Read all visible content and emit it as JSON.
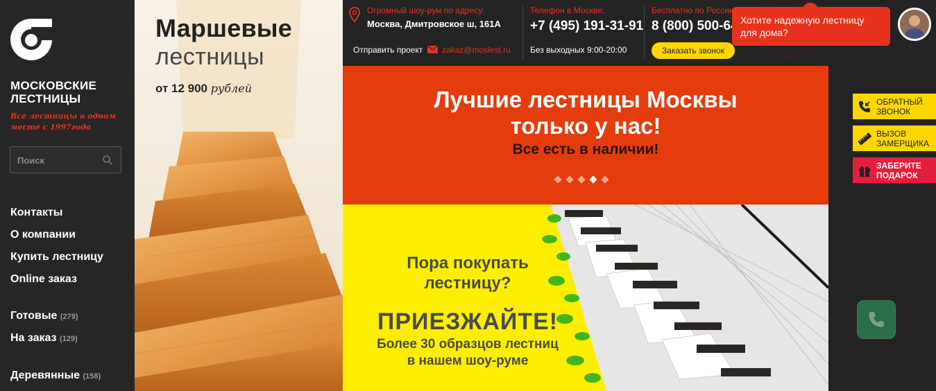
{
  "brand": {
    "name_line1": "МОСКОВСКИЕ",
    "name_line2": "ЛЕСТНИЦЫ",
    "tagline": "Все лестницы в одном месте с 1997года"
  },
  "search": {
    "placeholder": "Поиск"
  },
  "nav": {
    "items": [
      {
        "label": "Контакты"
      },
      {
        "label": "О компании"
      },
      {
        "label": "Купить лестницу"
      },
      {
        "label": "Online заказ"
      }
    ],
    "catalog": [
      {
        "label": "Готовые",
        "count": "(279)"
      },
      {
        "label": "На заказ",
        "count": "(129)"
      },
      {
        "label": "Деревянные",
        "count": "(158)"
      }
    ]
  },
  "stair_banner": {
    "title": "Маршевые",
    "subtitle": "лестницы",
    "price_prefix": "от 12 900",
    "price_unit": "рублей"
  },
  "topbar": {
    "showroom_label": "Огромный шоу-рум по адресу:",
    "showroom_address": "Москва, Дмитровское ш, 161А",
    "send_project_label": "Отправить проект",
    "email": "zakaz@moslest.ru",
    "moscow_phone_label": "Телефон в Москве:",
    "moscow_phone": "+7 (495) 191-31-91",
    "hours": "Без выходных 9:00-20:00",
    "russia_label": "Бесплатно по России:",
    "russia_phone": "8 (800) 500-64",
    "call_button": "Заказать звонок"
  },
  "red_banner": {
    "headline_line1": "Лучшие лестницы Москвы",
    "headline_line2": "только у нас!",
    "subheadline": "Все есть в наличии!",
    "active_dot": 3,
    "dot_count": 5
  },
  "yellow_banner": {
    "line1": "Пора покупать",
    "line2": "лестницу?",
    "cta": "ПРИЕЗЖАЙТЕ!",
    "line3": "Более 30 образцов лестниц",
    "line4": "в нашем шоу-руме"
  },
  "side_buttons": [
    {
      "line1": "ОБРАТНЫЙ",
      "line2": "ЗВОНОК",
      "color": "#ffd600",
      "icon": "phone-callback-icon"
    },
    {
      "line1": "ВЫЗОВ",
      "line2": "ЗАМЕРЩИКА",
      "color": "#ffd600",
      "icon": "ruler-icon"
    },
    {
      "line1": "ЗАБЕРИТЕ",
      "line2": "ПОДАРОК",
      "color": "#e41f3c",
      "icon": "gift-icon"
    }
  ],
  "popup": {
    "text": "Хотите надежную лестницу для дома?"
  },
  "colors": {
    "accent_red": "#e8321e",
    "banner_red": "#e43c0d",
    "banner_yellow": "#ffee00",
    "button_yellow": "#ffd600",
    "sidebar_bg": "#262626"
  }
}
